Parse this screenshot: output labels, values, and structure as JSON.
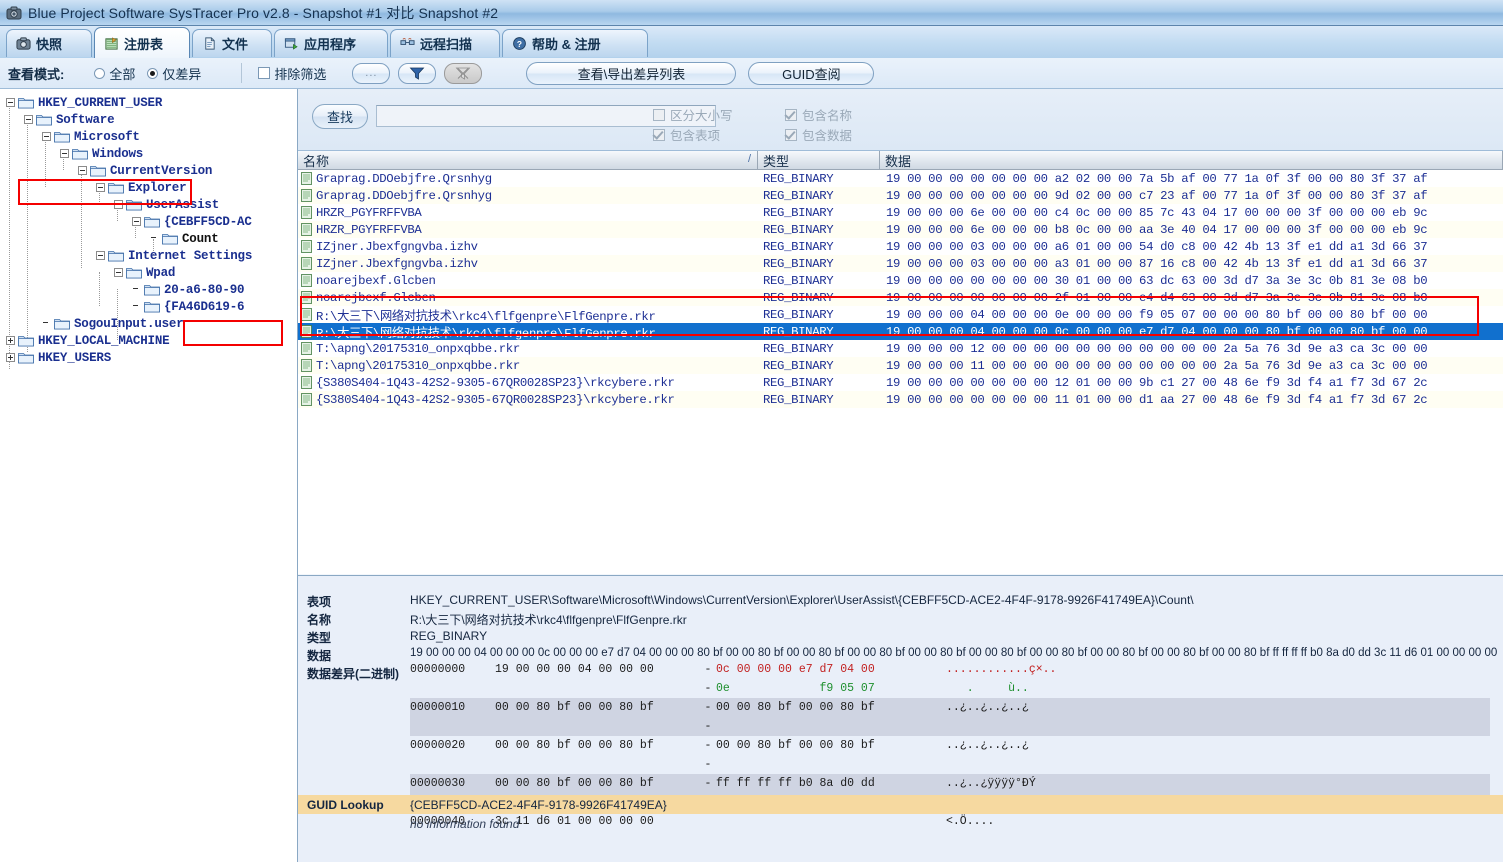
{
  "window": {
    "title": "Blue Project Software SysTracer Pro v2.8 - Snapshot #1 对比 Snapshot #2",
    "icon": "camera-icon"
  },
  "tabs": [
    {
      "label": "快照",
      "icon": "camera-icon",
      "active": false
    },
    {
      "label": "注册表",
      "icon": "registry-icon",
      "active": true
    },
    {
      "label": "文件",
      "icon": "file-icon",
      "active": false
    },
    {
      "label": "应用程序",
      "icon": "application-icon",
      "active": false
    },
    {
      "label": "远程扫描",
      "icon": "remote-scan-icon",
      "active": false
    },
    {
      "label": "帮助 & 注册",
      "icon": "help-icon",
      "active": false
    }
  ],
  "toolbar": {
    "view_mode_label": "查看模式:",
    "radio_all": "全部",
    "radio_diff_only": "仅差异",
    "radio_selected": "仅差异",
    "exclude_filter_label": "排除筛选",
    "exclude_filter_checked": false,
    "btn_ellipsis": "...",
    "btn_filter_icon": "funnel-icon",
    "btn_clear_filter_icon": "funnel-clear-icon",
    "btn_export_diff": "查看\\导出差异列表",
    "btn_guid_lookup": "GUID查阅"
  },
  "find": {
    "button": "查找",
    "input_value": "",
    "input_placeholder": "",
    "options": [
      {
        "label": "区分大小写",
        "checked": false
      },
      {
        "label": "包含名称",
        "checked": true
      },
      {
        "label": "包含表项",
        "checked": true
      },
      {
        "label": "包含数据",
        "checked": true
      }
    ]
  },
  "tree": [
    {
      "label": "HKEY_CURRENT_USER",
      "depth": 0,
      "state": "minus",
      "highlight": true
    },
    {
      "label": "Software",
      "depth": 1,
      "state": "minus"
    },
    {
      "label": "Microsoft",
      "depth": 2,
      "state": "minus"
    },
    {
      "label": "Windows",
      "depth": 3,
      "state": "minus"
    },
    {
      "label": "CurrentVersion",
      "depth": 4,
      "state": "minus"
    },
    {
      "label": "Explorer",
      "depth": 5,
      "state": "minus"
    },
    {
      "label": "UserAssist",
      "depth": 6,
      "state": "minus"
    },
    {
      "label": "{CEBFF5CD-AC",
      "depth": 7,
      "state": "minus"
    },
    {
      "label": "Count",
      "depth": 8,
      "state": "none",
      "selected": true,
      "highlight": true
    },
    {
      "label": "Internet Settings",
      "depth": 5,
      "state": "minus"
    },
    {
      "label": "Wpad",
      "depth": 6,
      "state": "minus"
    },
    {
      "label": "20-a6-80-90",
      "depth": 7,
      "state": "none"
    },
    {
      "label": "{FA46D619-6",
      "depth": 7,
      "state": "none"
    },
    {
      "label": "SogouInput.user",
      "depth": 2,
      "state": "none"
    },
    {
      "label": "HKEY_LOCAL_MACHINE",
      "depth": 0,
      "state": "plus"
    },
    {
      "label": "HKEY_USERS",
      "depth": 0,
      "state": "plus"
    }
  ],
  "list": {
    "columns": [
      {
        "label": "名称",
        "sort": "/"
      },
      {
        "label": "类型"
      },
      {
        "label": "数据"
      }
    ],
    "rows": [
      {
        "name": "Graprag.DDOebjfre.Qrsnhyg",
        "type": "REG_BINARY",
        "data": "19 00 00 00 00 00 00 00 a2 02 00 00 7a 5b af 00 77 1a 0f 3f 00 00 80 3f 37 af"
      },
      {
        "name": "Graprag.DDOebjfre.Qrsnhyg",
        "type": "REG_BINARY",
        "data": "19 00 00 00 00 00 00 00 9d 02 00 00 c7 23 af 00 77 1a 0f 3f 00 00 80 3f 37 af"
      },
      {
        "name": "HRZR_PGYFRFFVBA",
        "type": "REG_BINARY",
        "data": "19 00 00 00 6e 00 00 00 c4 0c 00 00 85 7c 43 04 17 00 00 00 3f 00 00 00 eb 9c"
      },
      {
        "name": "HRZR_PGYFRFFVBA",
        "type": "REG_BINARY",
        "data": "19 00 00 00 6e 00 00 00 b8 0c 00 00 aa 3e 40 04 17 00 00 00 3f 00 00 00 eb 9c"
      },
      {
        "name": "IZjner.Jbexfgngvba.izhv",
        "type": "REG_BINARY",
        "data": "19 00 00 00 03 00 00 00 a6 01 00 00 54 d0 c8 00 42 4b 13 3f e1 dd a1 3d 66 37"
      },
      {
        "name": "IZjner.Jbexfgngvba.izhv",
        "type": "REG_BINARY",
        "data": "19 00 00 00 03 00 00 00 a3 01 00 00 87 16 c8 00 42 4b 13 3f e1 dd a1 3d 66 37"
      },
      {
        "name": "noarejbexf.Glcben",
        "type": "REG_BINARY",
        "data": "19 00 00 00 00 00 00 00 30 01 00 00 63 dc 63 00 3d d7 3a 3e 3c 0b 81 3e 08 b0"
      },
      {
        "name": "noarejbexf.Glcben",
        "type": "REG_BINARY",
        "data": "19 00 00 00 00 00 00 00 2f 01 00 00 e4 d4 63 00 3d d7 3a 3e 3c 0b 81 3e 08 b0"
      },
      {
        "name": "R:\\大三下\\网络对抗技术\\rkc4\\flfgenpre\\FlfGenpre.rkr",
        "type": "REG_BINARY",
        "data": "19 00 00 00 04 00 00 00 0e 00 00 00 f9 05 07 00 00 00 80 bf 00 00 80 bf 00 00"
      },
      {
        "name": "R:\\大三下\\网络对抗技术\\rkc4\\flfgenpre\\FlfGenpre.rkr",
        "type": "REG_BINARY",
        "data": "19 00 00 00 04 00 00 00 0c 00 00 00 e7 d7 04 00 00 00 80 bf 00 00 80 bf 00 00",
        "selected": true
      },
      {
        "name": "T:\\apng\\20175310_onpxqbbe.rkr",
        "type": "REG_BINARY",
        "data": "19 00 00 00 12 00 00 00 00 00 00 00 00 00 00 00 2a 5a 76 3d 9e a3 ca 3c 00 00"
      },
      {
        "name": "T:\\apng\\20175310_onpxqbbe.rkr",
        "type": "REG_BINARY",
        "data": "19 00 00 00 11 00 00 00 00 00 00 00 00 00 00 00 2a 5a 76 3d 9e a3 ca 3c 00 00"
      },
      {
        "name": "{S380S404-1Q43-42S2-9305-67QR0028SP23}\\rkcybere.rkr",
        "type": "REG_BINARY",
        "data": "19 00 00 00 00 00 00 00 12 01 00 00 9b c1 27 00 48 6e f9 3d f4 a1 f7 3d 67 2c"
      },
      {
        "name": "{S380S404-1Q43-42S2-9305-67QR0028SP23}\\rkcybere.rkr",
        "type": "REG_BINARY",
        "data": "19 00 00 00 00 00 00 00 11 01 00 00 d1 aa 27 00 48 6e f9 3d f4 a1 f7 3d 67 2c"
      }
    ]
  },
  "details": {
    "labels": {
      "key": "表项",
      "name": "名称",
      "type": "类型",
      "data": "数据",
      "diff": "数据差异(二进制)",
      "guid": "GUID Lookup"
    },
    "key": "HKEY_CURRENT_USER\\Software\\Microsoft\\Windows\\CurrentVersion\\Explorer\\UserAssist\\{CEBFF5CD-ACE2-4F4F-9178-9926F41749EA}\\Count\\",
    "name": "R:\\大三下\\网络对抗技术\\rkc4\\flfgenpre\\FlfGenpre.rkr",
    "type": "REG_BINARY",
    "data": "19 00 00 00 04 00 00 00 0c 00 00 00 e7 d7 04 00 00 00 80 bf 00 00 80 bf 00 00 80 bf 00 00 80 bf 00 00 80 bf 00 00 80 bf 00 00 80 bf 00 00 80 bf 00 00 80 bf 00 00 80 bf ff ff ff ff b0 8a d0 dd 3c 11 d6 01 00 00 00 00",
    "guid_value": "{CEBFF5CD-ACE2-4F4F-9178-9926F41749EA}",
    "guid_result": "no information found",
    "hexdump": [
      {
        "offset": "00000000",
        "a": "19 00 00 00 04 00 00 00",
        "b": "0c 00 00 00 e7 d7 04 00",
        "ascii": "............ç×..",
        "b_color": "red",
        "band": false
      },
      {
        "offset": "",
        "a": "",
        "b": "0e             f9 05 07",
        "ascii": "   .     ù..",
        "b_color": "green",
        "band": false
      },
      {
        "offset": "00000010",
        "a": "00 00 80 bf 00 00 80 bf",
        "b": "00 00 80 bf 00 00 80 bf",
        "ascii": "..¿..¿..¿..¿",
        "b_color": "",
        "band": true
      },
      {
        "offset": "",
        "a": "",
        "b": "",
        "ascii": "",
        "b_color": "",
        "band": true
      },
      {
        "offset": "00000020",
        "a": "00 00 80 bf 00 00 80 bf",
        "b": "00 00 80 bf 00 00 80 bf",
        "ascii": "..¿..¿..¿..¿",
        "b_color": "",
        "band": false
      },
      {
        "offset": "",
        "a": "",
        "b": "",
        "ascii": "",
        "b_color": "",
        "band": false
      },
      {
        "offset": "00000030",
        "a": "00 00 80 bf 00 00 80 bf",
        "b": "ff ff ff ff b0 8a d0 dd",
        "ascii": "..¿..¿ÿÿÿÿ°ÐÝ",
        "b_color": "",
        "band": true
      },
      {
        "offset": "",
        "a": "",
        "b": "",
        "ascii": "",
        "b_color": "",
        "band": true
      },
      {
        "offset": "00000040",
        "a": "3c 11 d6 01 00 00 00 00",
        "b": "",
        "ascii": "<.Ö....",
        "b_color": "",
        "band": false
      }
    ]
  },
  "colors": {
    "accent": "#1170ce",
    "annotation": "#f40000",
    "guid_band": "#f6d9a0",
    "tree_text": "#1a2f8f"
  }
}
